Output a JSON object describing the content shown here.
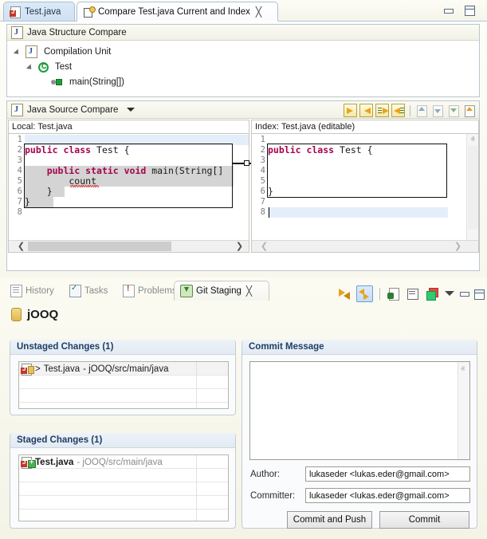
{
  "editor": {
    "tabs": [
      {
        "label": "Test.java",
        "icon": "java-file-icon",
        "active": false,
        "closable": false
      },
      {
        "label": "Compare Test.java Current and Index",
        "icon": "compare-icon",
        "active": true,
        "closable": true
      }
    ],
    "window_controls": [
      "minimize",
      "maximize"
    ],
    "structure_compare": {
      "title": "Java Structure Compare",
      "tree": [
        {
          "label": "Compilation Unit",
          "icon": "java-file-icon",
          "depth": 0,
          "expanded": true
        },
        {
          "label": "Test",
          "icon": "java-class-icon",
          "depth": 1,
          "expanded": true
        },
        {
          "label": "main(String[])",
          "icon": "java-method-icon",
          "depth": 2,
          "expanded": null
        }
      ]
    },
    "source_compare": {
      "title": "Java Source Compare",
      "toolbar": [
        "copy-current-change-right-icon",
        "copy-current-change-left-icon",
        "copy-all-changes-right-icon",
        "copy-all-changes-left-icon",
        "select-next-difference-icon",
        "select-previous-difference-icon",
        "select-next-change-icon",
        "select-previous-change-icon"
      ],
      "left": {
        "header": "Local: Test.java",
        "lines": [
          {
            "n": "1",
            "text": ""
          },
          {
            "n": "2",
            "text": "public class Test {"
          },
          {
            "n": "3",
            "text": ""
          },
          {
            "n": "4",
            "text": "    public static void main(String[]"
          },
          {
            "n": "5",
            "text": "        count"
          },
          {
            "n": "6",
            "text": "    }"
          },
          {
            "n": "7",
            "text": "}"
          },
          {
            "n": "8",
            "text": ""
          }
        ],
        "scroll": {
          "horizontal": true,
          "left_arrow": "❮",
          "right_arrow": "❯"
        }
      },
      "right": {
        "header": "Index: Test.java (editable)",
        "lines": [
          {
            "n": "1",
            "text": ""
          },
          {
            "n": "2",
            "text": "public class Test {"
          },
          {
            "n": "3",
            "text": ""
          },
          {
            "n": "4",
            "text": ""
          },
          {
            "n": "5",
            "text": ""
          },
          {
            "n": "6",
            "text": "}"
          },
          {
            "n": "7",
            "text": ""
          },
          {
            "n": "8",
            "text": ""
          }
        ],
        "scroll": {
          "vertical": true,
          "up_arrow": "ⱏ",
          "down_arrow": "ⱟ",
          "h_left_arrow": "❮",
          "h_right_arrow": "❯"
        }
      }
    }
  },
  "bottom": {
    "tabs": [
      {
        "label": "History",
        "icon": "history-icon",
        "active": false
      },
      {
        "label": "Tasks",
        "icon": "tasks-icon",
        "active": false
      },
      {
        "label": "Problems",
        "icon": "problems-icon",
        "active": false
      },
      {
        "label": "Git Staging",
        "icon": "git-staging-icon",
        "active": true,
        "closable": true
      }
    ],
    "toolbar": [
      "refresh-icon",
      "link-with-editor-and-selection-icon",
      "open-git-repositories-view-icon",
      "presentation-icon",
      "compare-mode-icon",
      "view-menu-icon",
      "minimize-icon",
      "maximize-icon"
    ],
    "repository": {
      "name": "jOOQ",
      "icon": "repository-icon"
    },
    "unstaged": {
      "title": "Unstaged Changes (1)",
      "rows": [
        {
          "prefix": "> ",
          "name": "Test.java",
          "path": " - jOOQ/src/main/java",
          "icon": "java-file-modified-icon",
          "selected": true
        }
      ],
      "empty_rows": 4
    },
    "staged": {
      "title": "Staged Changes (1)",
      "rows": [
        {
          "prefix": "",
          "name": "Test.java",
          "path": " - jOOQ/src/main/java",
          "icon": "java-file-added-icon",
          "selected": false
        }
      ],
      "empty_rows": 5
    },
    "commit": {
      "title": "Commit Message",
      "message_value": "",
      "author_label": "Author:",
      "author_value": "lukaseder <lukas.eder@gmail.com>",
      "committer_label": "Committer:",
      "committer_value": "lukaseder <lukas.eder@gmail.com>",
      "commit_and_push_label": "Commit and Push",
      "commit_label": "Commit"
    }
  },
  "colors": {
    "keyword": "#a3054f",
    "diff_block": "#d4d4d4",
    "current_line": "#e4eefb",
    "accent_blue": "#1f3d63"
  }
}
